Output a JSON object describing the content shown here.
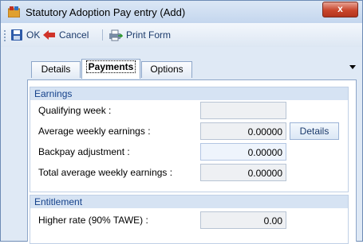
{
  "window": {
    "title": "Statutory Adoption Pay entry (Add)",
    "close_label": "x"
  },
  "toolbar": {
    "ok_label": "OK",
    "cancel_label": "Cancel",
    "print_label": "Print Form"
  },
  "tabs": [
    {
      "label": "Details"
    },
    {
      "label": "Payments",
      "active": true
    },
    {
      "label": "Options"
    }
  ],
  "earnings": {
    "header": "Earnings",
    "qualifying_week_label": "Qualifying week :",
    "qualifying_week_value": "",
    "average_weekly_label": "Average weekly earnings :",
    "average_weekly_value": "0.00000",
    "details_button": "Details",
    "backpay_label": "Backpay adjustment :",
    "backpay_value": "0.00000",
    "total_average_label": "Total average weekly earnings :",
    "total_average_value": "0.00000"
  },
  "entitlement": {
    "header": "Entitlement",
    "higher_rate_label": "Higher rate (90% TAWE) :",
    "higher_rate_value": "0.00"
  },
  "colors": {
    "accent": "#15428b",
    "window_bg": "#dfe9f5",
    "close_red": "#c9462c"
  }
}
